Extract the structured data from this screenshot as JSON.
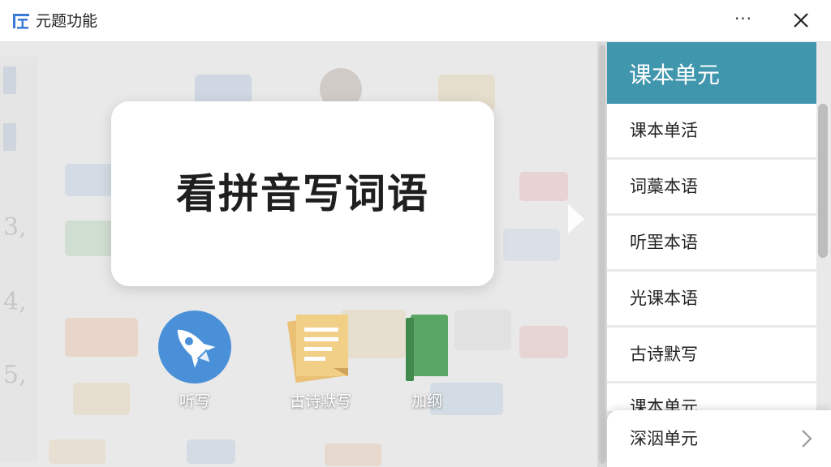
{
  "window": {
    "title": "元题功能",
    "logo_icon": "app-logo-icon",
    "more_label": "···",
    "close_icon": "close-icon"
  },
  "stage": {
    "card_text": "看拼音写词语",
    "features": [
      {
        "label": "听写",
        "icon": "rocket-icon",
        "color": "#4a90d9"
      },
      {
        "label": "古诗默写",
        "icon": "note-paper-icon",
        "color": "#e9c074"
      },
      {
        "label": "加纲",
        "icon": "green-book-icon",
        "color": "#5aa765"
      }
    ],
    "next_icon": "next-arrow-icon"
  },
  "panel": {
    "header": "课本单元",
    "accent_color": "#3f96ad",
    "items": [
      "课本单活",
      "词藁本语",
      "听罜本语",
      "光课本语",
      "古诗默写",
      "课本单元"
    ],
    "floating_item": "深洇单元",
    "chevron_icon": "chevron-right-icon"
  }
}
